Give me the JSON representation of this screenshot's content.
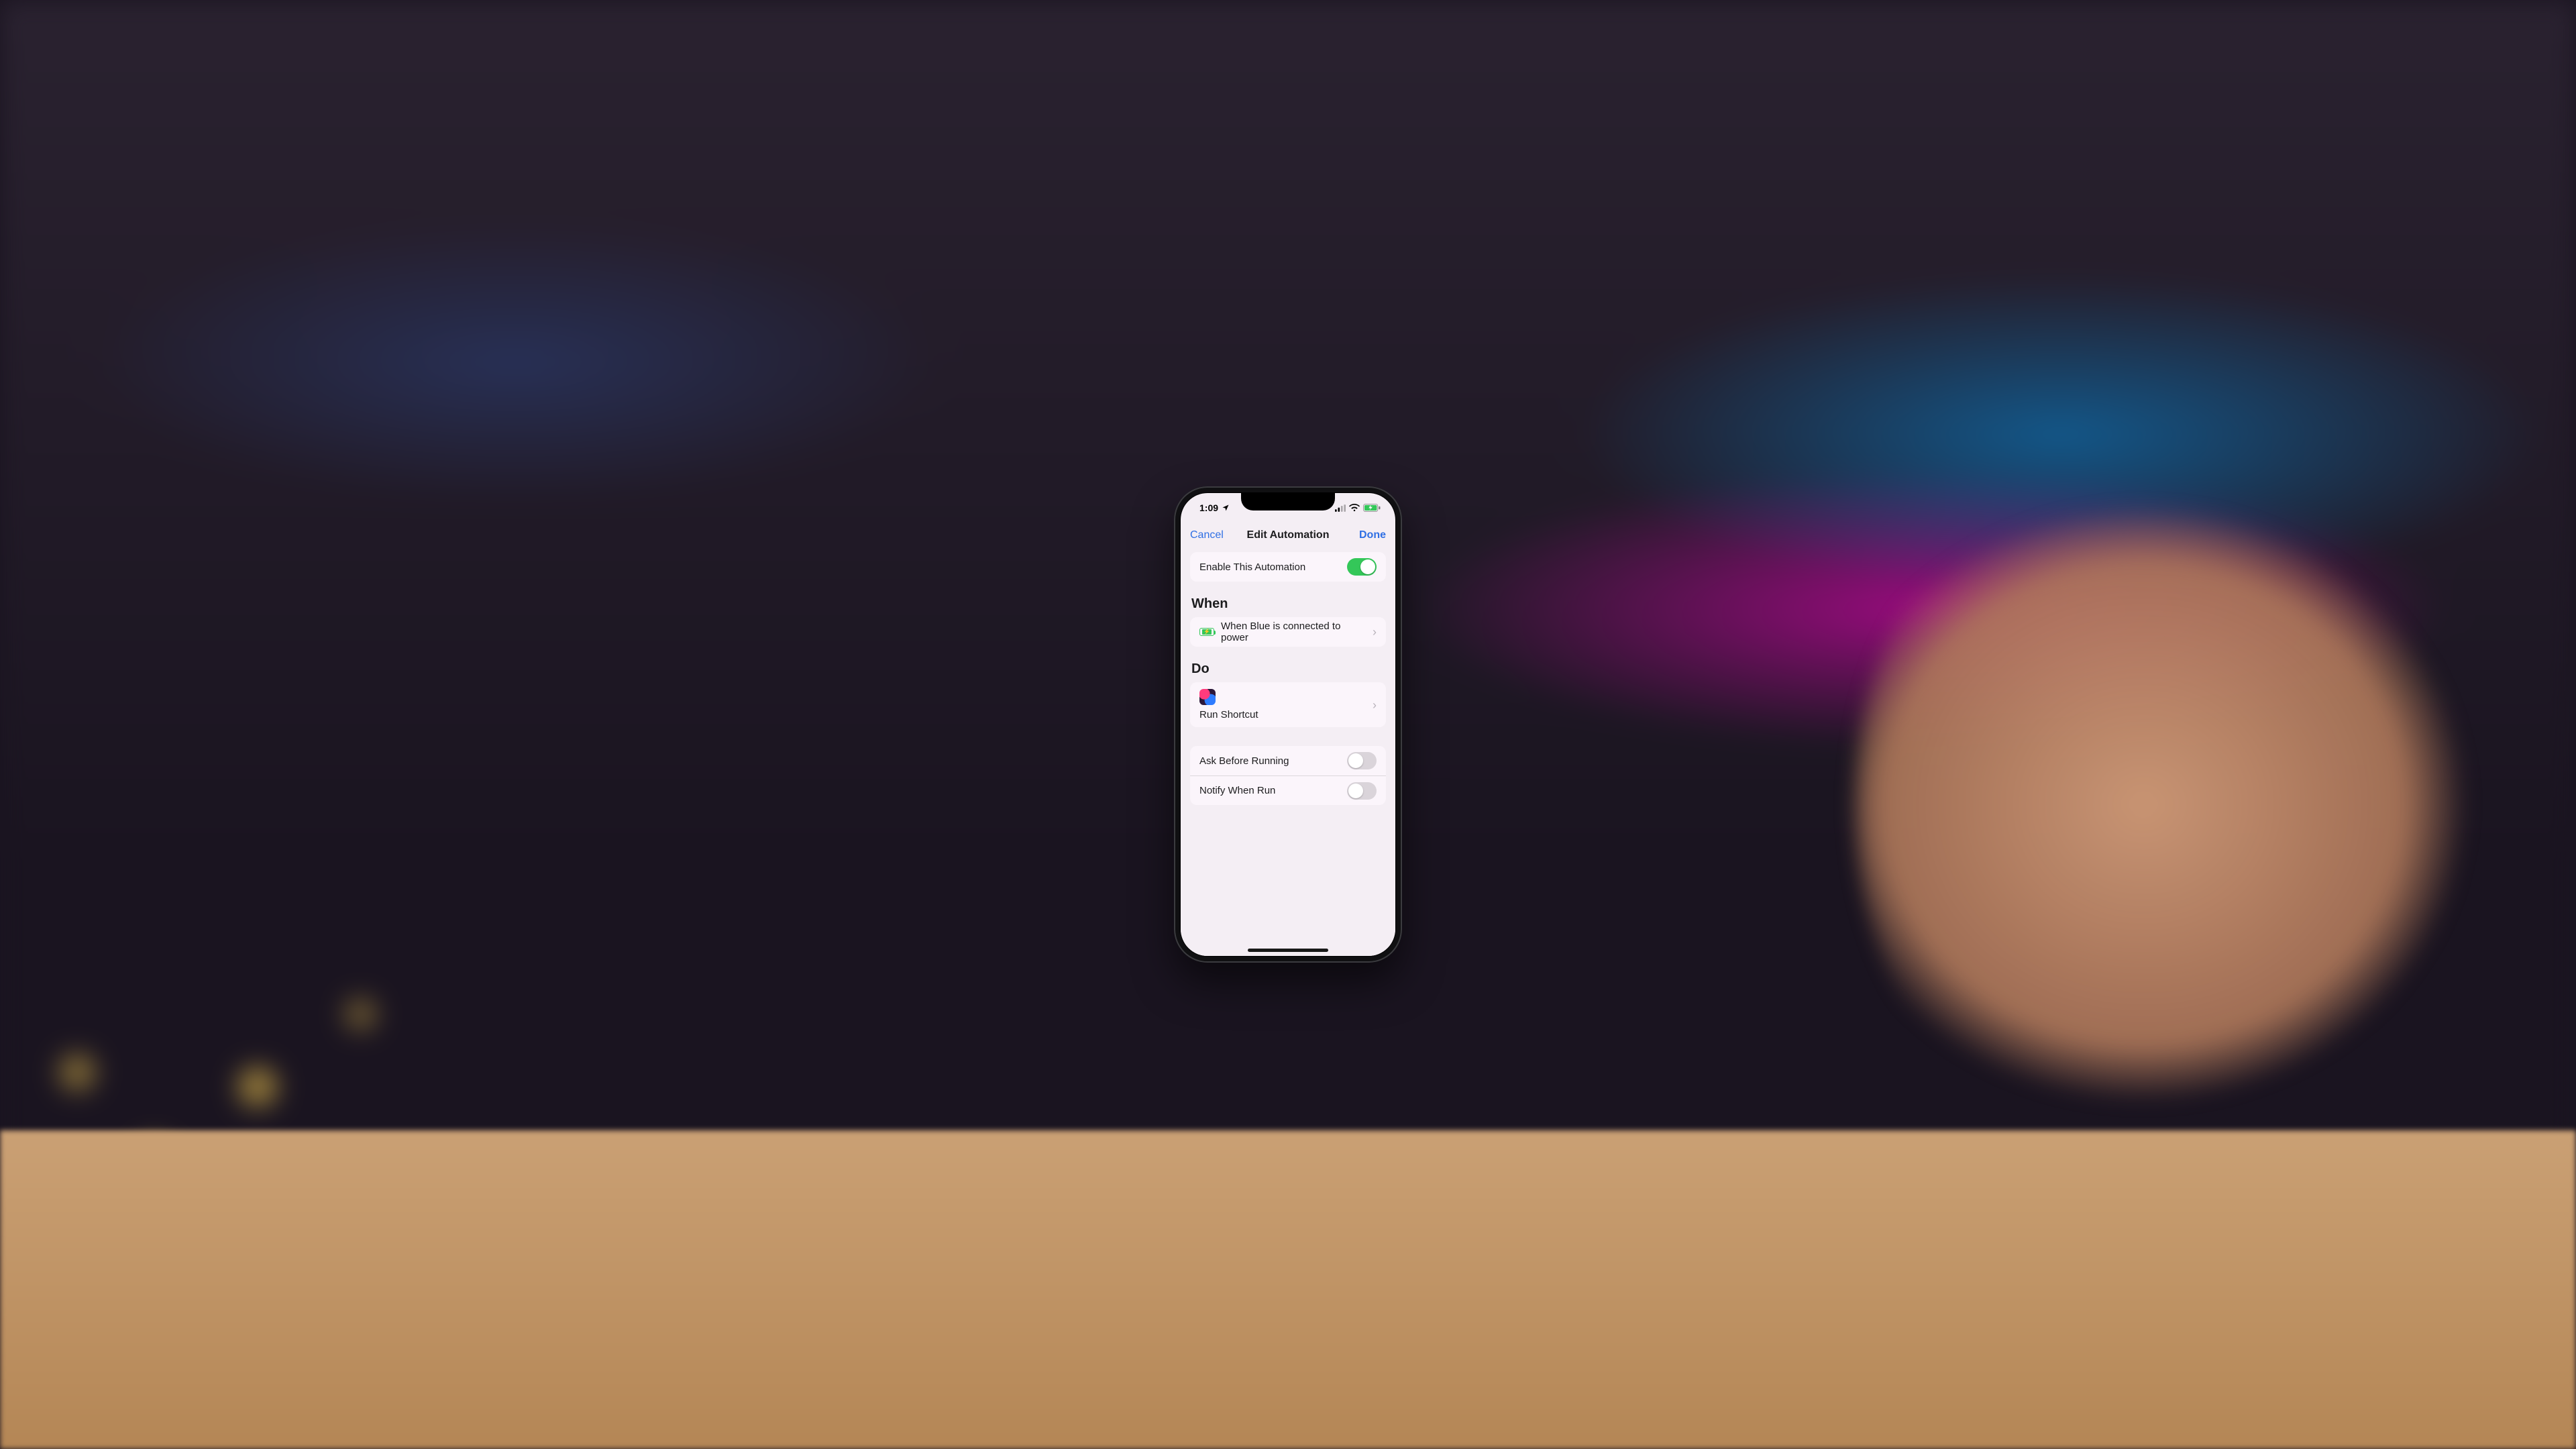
{
  "status": {
    "time": "1:09",
    "location_active": true
  },
  "nav": {
    "cancel": "Cancel",
    "title": "Edit Automation",
    "done": "Done"
  },
  "enable": {
    "label": "Enable This Automation",
    "on": true
  },
  "sections": {
    "when_header": "When",
    "when_text": "When Blue is connected to power",
    "do_header": "Do",
    "do_action": "Run Shortcut"
  },
  "options": {
    "ask_label": "Ask Before Running",
    "ask_on": false,
    "notify_label": "Notify When Run",
    "notify_on": false
  },
  "colors": {
    "tint": "#2f6fe4",
    "switch_on": "#34c759"
  }
}
